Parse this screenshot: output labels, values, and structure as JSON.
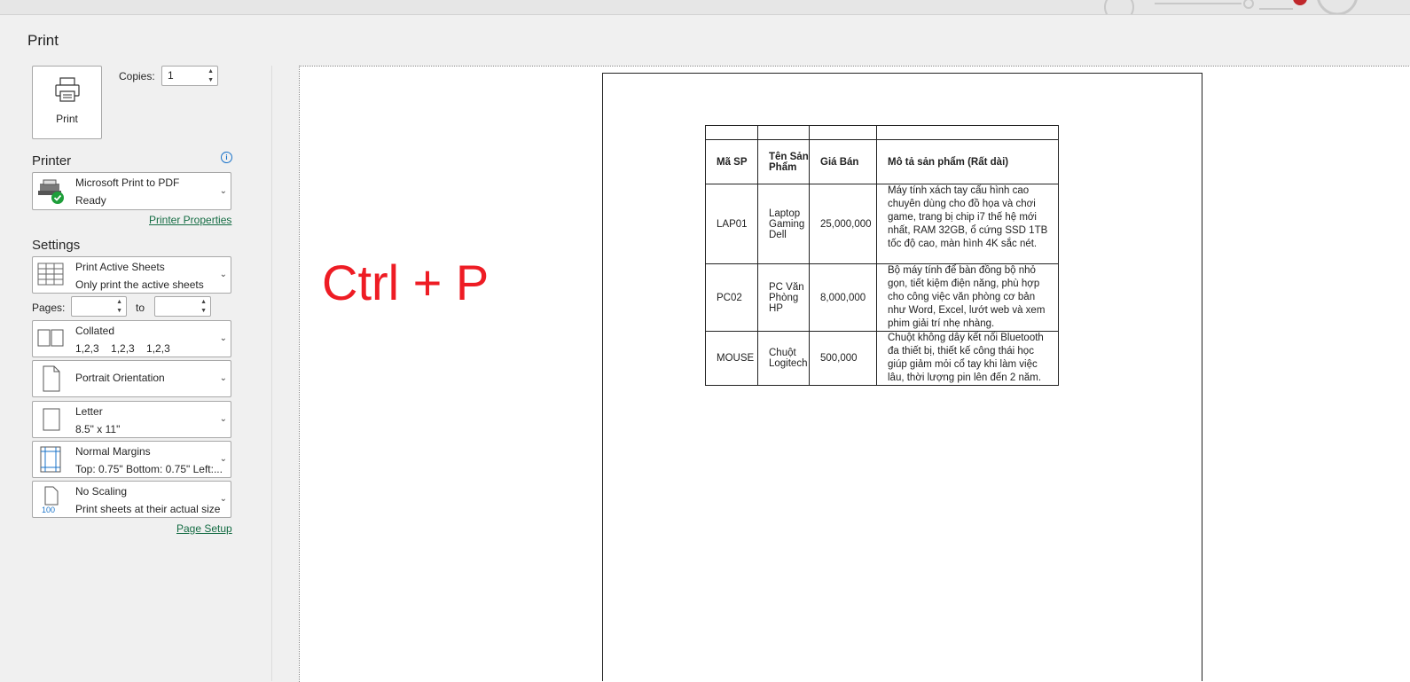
{
  "page": {
    "title": "Print"
  },
  "print_button": {
    "label": "Print"
  },
  "copies": {
    "label": "Copies:",
    "value": "1"
  },
  "printer": {
    "section_label": "Printer",
    "name": "Microsoft Print to PDF",
    "status": "Ready",
    "properties_link": "Printer Properties"
  },
  "settings": {
    "section_label": "Settings",
    "scope": {
      "title": "Print Active Sheets",
      "subtitle": "Only print the active sheets"
    },
    "pages": {
      "label": "Pages:",
      "to_label": "to",
      "from": "",
      "to": ""
    },
    "collation": {
      "title": "Collated",
      "subtitle": "1,2,3    1,2,3    1,2,3"
    },
    "orientation": {
      "title": "Portrait Orientation"
    },
    "paper": {
      "title": "Letter",
      "subtitle": "8.5\" x 11\""
    },
    "margins": {
      "title": "Normal Margins",
      "subtitle": "Top: 0.75\" Bottom: 0.75\" Left:..."
    },
    "scaling": {
      "title": "No Scaling",
      "subtitle": "Print sheets at their actual size",
      "icon_text": "100"
    },
    "page_setup_link": "Page Setup"
  },
  "preview": {
    "overlay_hint": "Ctrl + P",
    "table": {
      "headers": [
        "Mã SP",
        "Tên Sản Phẩm",
        "Giá Bán",
        "Mô tả sản phẩm (Rất dài)"
      ],
      "rows": [
        {
          "code": "LAP01",
          "name": "Laptop Gaming Dell",
          "price": "25,000,000",
          "description": "Máy tính xách tay cấu hình cao chuyên dùng cho đồ họa và chơi game, trang bị chip i7 thế hệ mới nhất, RAM 32GB, ổ cứng SSD 1TB tốc độ cao, màn hình 4K sắc nét."
        },
        {
          "code": "PC02",
          "name": "PC Văn Phòng HP",
          "price": "8,000,000",
          "description": "Bộ máy tính để bàn đồng bộ nhỏ gọn, tiết kiệm điện năng, phù hợp cho công việc văn phòng cơ bản như Word, Excel, lướt web và xem phim giải trí nhẹ nhàng."
        },
        {
          "code": "MOUSE",
          "name": "Chuột Logitech",
          "price": "500,000",
          "description": "Chuột không dây kết nối Bluetooth đa thiết bị, thiết kế công thái học giúp giảm mỏi cổ tay khi làm việc lâu, thời lượng pin lên đến 2 năm."
        }
      ]
    }
  },
  "icons": {
    "print": "printer-icon",
    "printer_status": "printer-ready-icon",
    "info": "info-icon",
    "scope": "sheet-grid-icon",
    "collation": "collated-pages-icon",
    "orientation": "portrait-page-icon",
    "paper": "letter-page-icon",
    "margins": "margins-icon",
    "scaling": "scaling-icon",
    "chevron": "chevron-down-icon"
  },
  "colors": {
    "accent_link": "#146c43",
    "hint": "#ee1c24",
    "info": "#1a73c9"
  }
}
